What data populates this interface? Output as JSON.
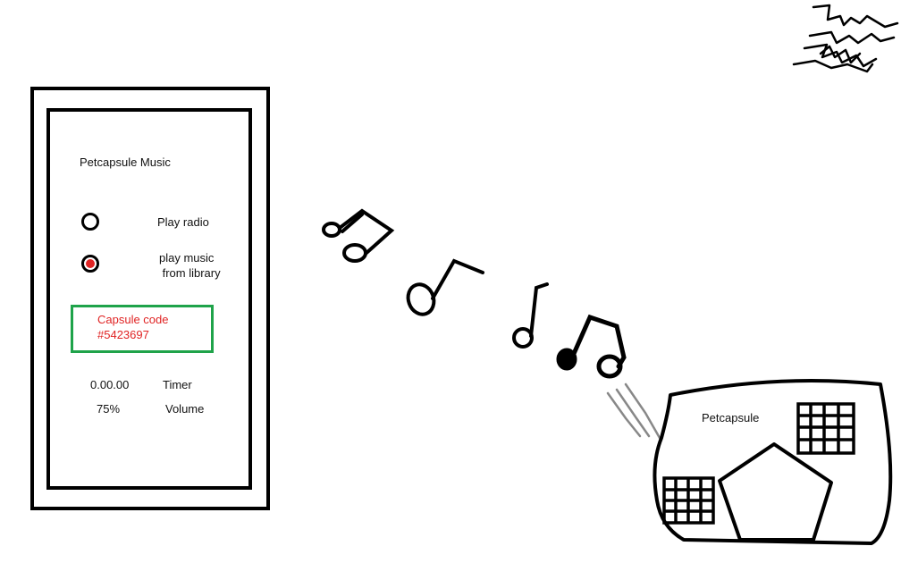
{
  "player": {
    "title": "Petcapsule Music",
    "options": [
      {
        "label": "Play radio",
        "selected": false
      },
      {
        "label": "play music\n from library",
        "selected": true
      }
    ],
    "capsule_code": {
      "label": "Capsule code",
      "value": "#5423697"
    },
    "timer": {
      "value": "0.00.00",
      "label": "Timer"
    },
    "volume": {
      "value": "75%",
      "label": "Volume"
    }
  },
  "capsule": {
    "label": "Petcapsule"
  },
  "icons": [
    "music-note-icon",
    "eighth-note-icon",
    "signature-scribble"
  ],
  "colors": {
    "outline": "#000000",
    "selected_dot": "#e02424",
    "code_text": "#e02424",
    "code_border": "#1fa34a",
    "sound_lines": "#888888"
  }
}
